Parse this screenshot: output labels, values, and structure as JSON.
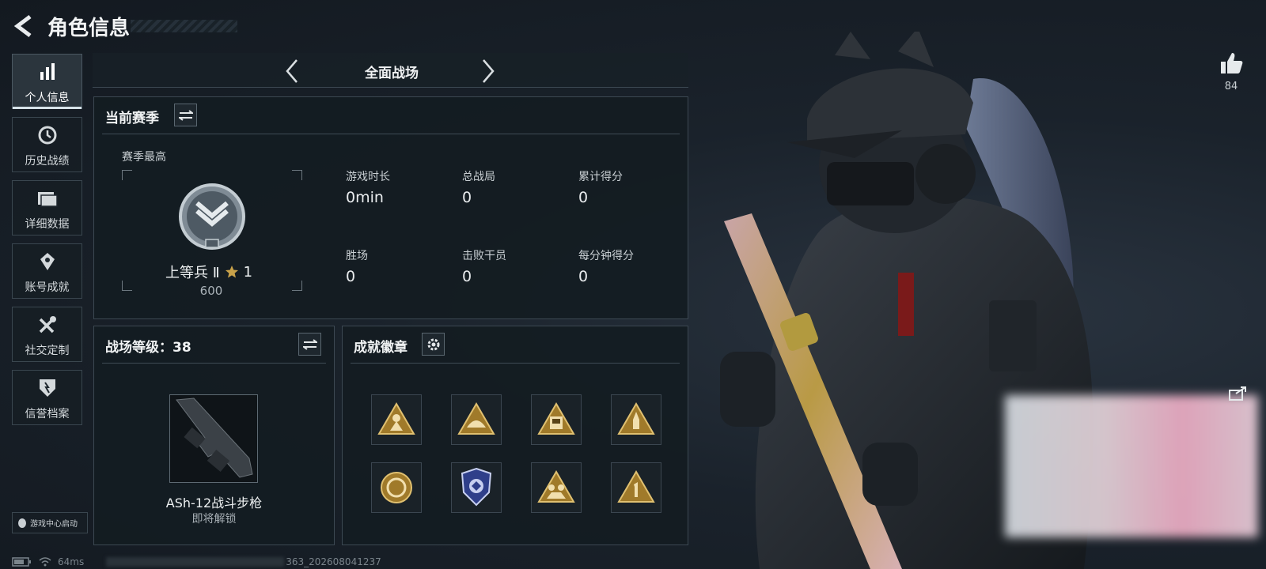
{
  "header": {
    "title": "角色信息"
  },
  "sidebar": {
    "items": [
      {
        "label": "个人信息",
        "icon": "bar-chart-icon",
        "active": true
      },
      {
        "label": "历史战绩",
        "icon": "history-icon"
      },
      {
        "label": "详细数据",
        "icon": "folder-icon"
      },
      {
        "label": "账号成就",
        "icon": "achievement-icon"
      },
      {
        "label": "社交定制",
        "icon": "tools-icon"
      },
      {
        "label": "信誉档案",
        "icon": "credit-icon"
      }
    ],
    "game_center_label": "游戏中心启动"
  },
  "mode_selector": {
    "label": "全面战场"
  },
  "season": {
    "title": "当前赛季",
    "best_label": "赛季最高",
    "rank_name": "上等兵 Ⅱ",
    "rank_stars": "1",
    "rank_points": "600",
    "stats": [
      {
        "label": "游戏时长",
        "value": "0min"
      },
      {
        "label": "总战局",
        "value": "0"
      },
      {
        "label": "累计得分",
        "value": "0"
      },
      {
        "label": "胜场",
        "value": "0"
      },
      {
        "label": "击败干员",
        "value": "0"
      },
      {
        "label": "每分钟得分",
        "value": "0"
      }
    ]
  },
  "battlefield": {
    "level_title": "战场等级：38",
    "weapon_name": "ASh-12战斗步枪",
    "weapon_status": "即将解锁"
  },
  "achievements": {
    "title": "成就徽章",
    "badges": [
      {
        "icon": "soldier-triangle-icon"
      },
      {
        "icon": "helmet-triangle-icon"
      },
      {
        "icon": "badge-58-triangle-icon"
      },
      {
        "icon": "rocket-triangle-icon"
      },
      {
        "icon": "coin-circle-icon"
      },
      {
        "icon": "shield-eagle-icon"
      },
      {
        "icon": "squad-triangle-icon"
      },
      {
        "icon": "number-one-triangle-icon"
      }
    ]
  },
  "like": {
    "count": "84"
  },
  "status_bar": {
    "ping": "64ms",
    "build": "363_202608041237"
  },
  "colors": {
    "accent_gold": "#c9a24a",
    "panel_border": "#3c4852",
    "background": "#161d24"
  }
}
